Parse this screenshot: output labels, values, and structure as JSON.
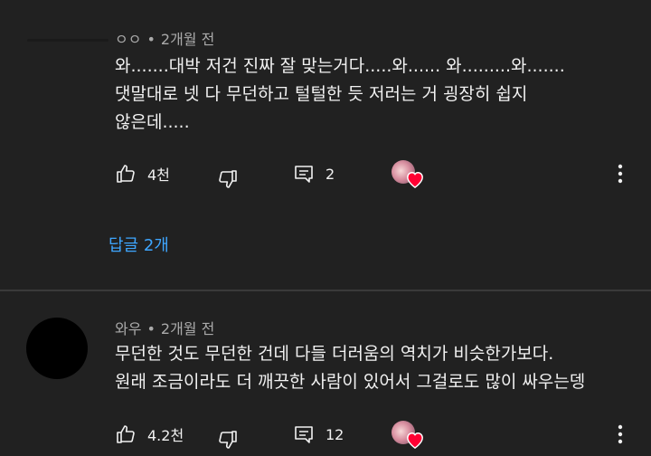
{
  "comments": [
    {
      "author": "ㅇㅇ",
      "time": "2개월 전",
      "separator": "•",
      "text_lines": [
        "와.......대박 저건 진짜 잘 맞는거다.....와...... 와.........와.......",
        "댓말대로 넷 다 무던하고 털털한 듯 저러는 거 굉장히 쉽지",
        "않은데....."
      ],
      "likes": "4천",
      "replies_count": "2",
      "replies_link": "답글 2개"
    },
    {
      "author": "와우",
      "time": "2개월 전",
      "separator": "•",
      "text_lines": [
        "무던한 것도 무던한 건데 다들 더러움의 역치가 비슷한가보다.",
        "원래 조금이라도 더 깨끗한 사람이 있어서 그걸로도 많이 싸우는뎅"
      ],
      "likes": "4.2천",
      "replies_count": "12"
    }
  ],
  "colors": {
    "background": "#212121",
    "text": "#f1f1f1",
    "meta": "#aaaaaa",
    "link": "#3ea6ff",
    "heart": "#ff0033"
  },
  "icons": [
    "thumb-up-icon",
    "thumb-down-icon",
    "reply-icon",
    "creator-heart-icon",
    "more-vert-icon"
  ]
}
